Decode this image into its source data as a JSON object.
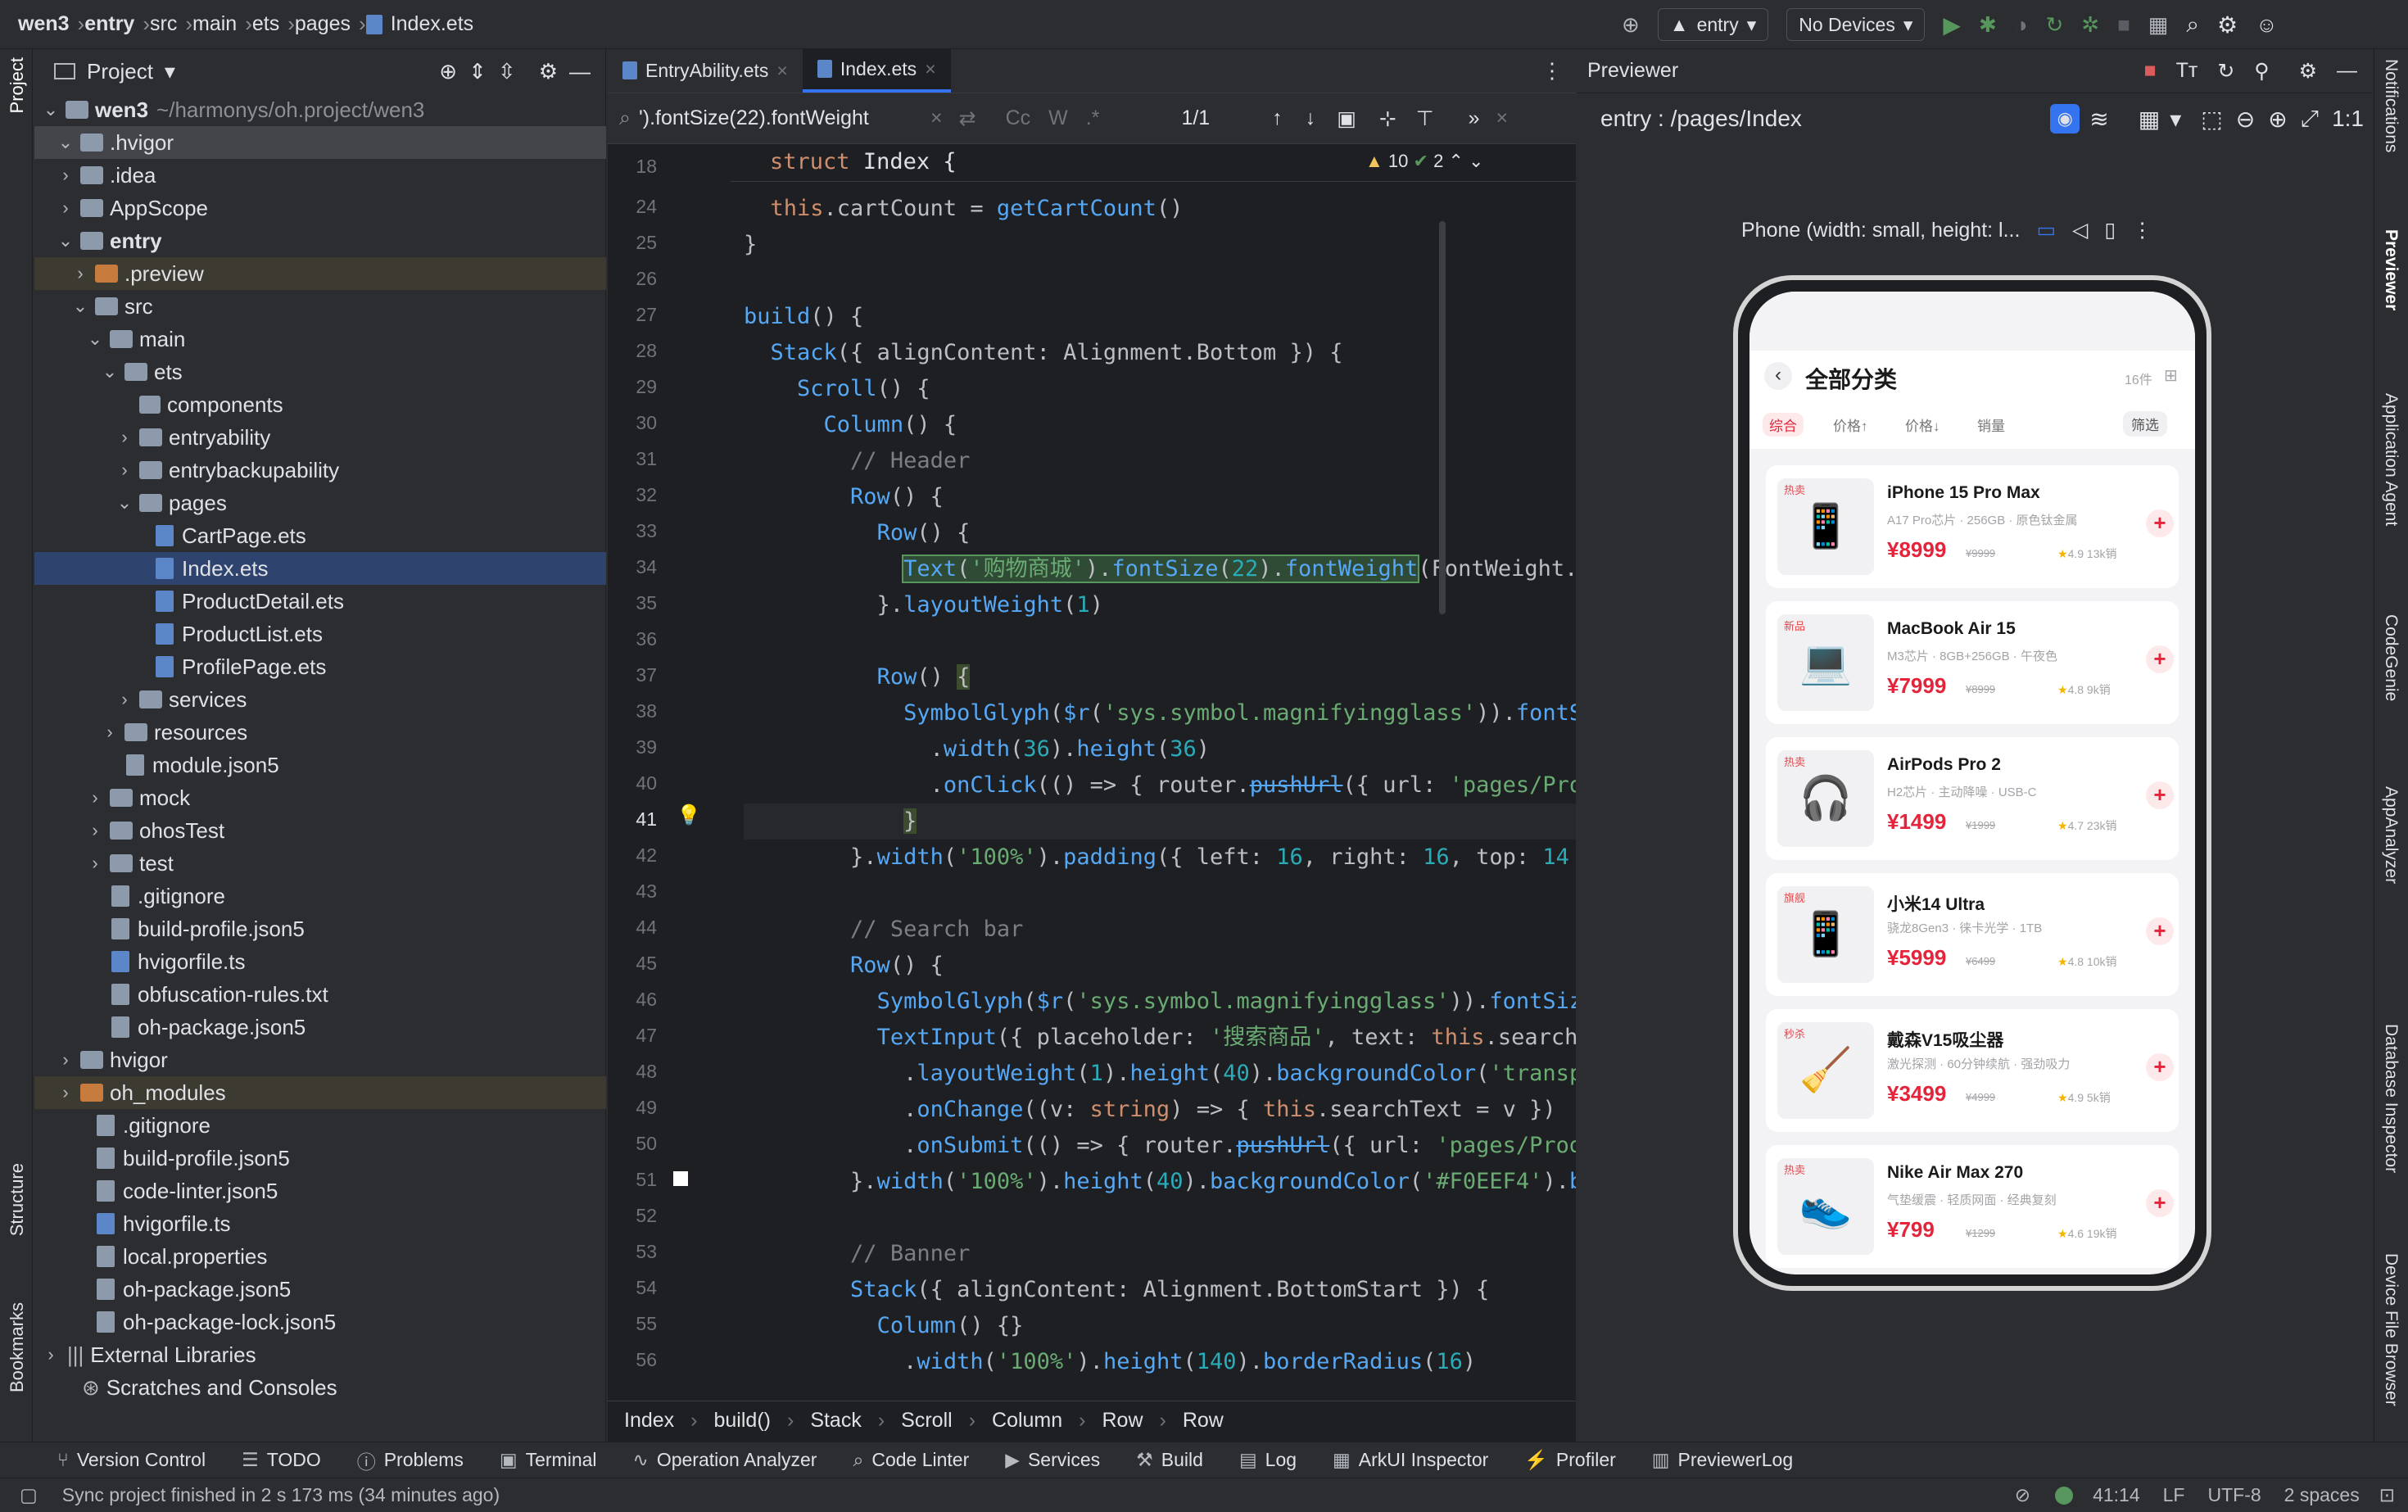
{
  "breadcrumb": [
    "wen3",
    "entry",
    "src",
    "main",
    "ets",
    "pages",
    "Index.ets"
  ],
  "toolbar": {
    "run_config": "entry",
    "device": "No Devices"
  },
  "left_strip": {
    "project": "Project",
    "structure": "Structure",
    "bookmarks": "Bookmarks"
  },
  "project": {
    "title": "Project",
    "root_name": "wen3",
    "root_path": "~/harmonys/oh.project/wen3",
    "items": [
      ".hvigor",
      ".idea",
      "AppScope",
      "entry",
      ".preview",
      "src",
      "main",
      "ets",
      "components",
      "entryability",
      "entrybackupability",
      "pages",
      "CartPage.ets",
      "Index.ets",
      "ProductDetail.ets",
      "ProductList.ets",
      "ProfilePage.ets",
      "services",
      "resources",
      "module.json5",
      "mock",
      "ohosTest",
      "test",
      ".gitignore",
      "build-profile.json5",
      "hvigorfile.ts",
      "obfuscation-rules.txt",
      "oh-package.json5",
      "hvigor",
      "oh_modules",
      ".gitignore",
      "build-profile.json5",
      "code-linter.json5",
      "hvigorfile.ts",
      "local.properties",
      "oh-package.json5",
      "oh-package-lock.json5",
      "External Libraries",
      "Scratches and Consoles"
    ]
  },
  "editor": {
    "tabs": [
      "EntryAbility.ets",
      "Index.ets"
    ],
    "find_query": "').fontSize(22).fontWeight",
    "find_count": "1/1",
    "find_opts": [
      "Cc",
      "W",
      ".*"
    ],
    "sticky": "struct Index {",
    "warnings": "10",
    "checks": "2",
    "line_numbers": [
      "18",
      "24",
      "25",
      "26",
      "27",
      "28",
      "29",
      "30",
      "31",
      "32",
      "33",
      "34",
      "35",
      "36",
      "37",
      "38",
      "39",
      "40",
      "41",
      "42",
      "43",
      "44",
      "45",
      "46",
      "47",
      "48",
      "49",
      "50",
      "51",
      "52",
      "53",
      "54",
      "55",
      "56"
    ],
    "breadcrumbs": [
      "Index",
      "build()",
      "Stack",
      "Scroll",
      "Column",
      "Row",
      "Row"
    ]
  },
  "previewer": {
    "title": "Previewer",
    "route": "entry : /pages/Index",
    "device_label": "Phone (width: small, height: l...",
    "app": {
      "title": "全部分类",
      "count": "16件",
      "filters": [
        "综合",
        "价格↑",
        "价格↓",
        "销量"
      ],
      "filter_btn": "筛选",
      "products": [
        {
          "tag": "热卖",
          "name": "iPhone 15 Pro Max",
          "sub": "A17 Pro芯片 · 256GB · 原色钛金属",
          "price": "¥8999",
          "old": "¥9999",
          "rating": "4.9 13k销"
        },
        {
          "tag": "新品",
          "name": "MacBook Air 15",
          "sub": "M3芯片 · 8GB+256GB · 午夜色",
          "price": "¥7999",
          "old": "¥8999",
          "rating": "4.8 9k销"
        },
        {
          "tag": "热卖",
          "name": "AirPods Pro 2",
          "sub": "H2芯片 · 主动降噪 · USB-C",
          "price": "¥1499",
          "old": "¥1999",
          "rating": "4.7 23k销"
        },
        {
          "tag": "旗舰",
          "name": "小米14 Ultra",
          "sub": "骁龙8Gen3 · 徕卡光学 · 1TB",
          "price": "¥5999",
          "old": "¥6499",
          "rating": "4.8 10k销"
        },
        {
          "tag": "秒杀",
          "name": "戴森V15吸尘器",
          "sub": "激光探测 · 60分钟续航 · 强劲吸力",
          "price": "¥3499",
          "old": "¥4999",
          "rating": "4.9 5k销"
        },
        {
          "tag": "热卖",
          "name": "Nike Air Max 270",
          "sub": "气垫缓震 · 轻质网面 · 经典复刻",
          "price": "¥799",
          "old": "¥1299",
          "rating": "4.6 19k销"
        }
      ]
    }
  },
  "right_strip": [
    "Notifications",
    "Previewer",
    "Application Agent",
    "CodeGenie",
    "AppAnalyzer",
    "Database Inspector",
    "Device File Browser"
  ],
  "bottom_tools": [
    "Version Control",
    "TODO",
    "Problems",
    "Terminal",
    "Operation Analyzer",
    "Code Linter",
    "Services",
    "Build",
    "Log",
    "ArkUI Inspector",
    "Profiler",
    "PreviewerLog"
  ],
  "status": {
    "message": "Sync project finished in 2 s 173 ms (34 minutes ago)",
    "position": "41:14",
    "line_sep": "LF",
    "encoding": "UTF-8",
    "indent": "2 spaces"
  },
  "colors": {
    "accent": "#3574f0",
    "brand_red": "#e5243b",
    "editor_bg": "#1e1f22",
    "panel_bg": "#2b2d30"
  }
}
